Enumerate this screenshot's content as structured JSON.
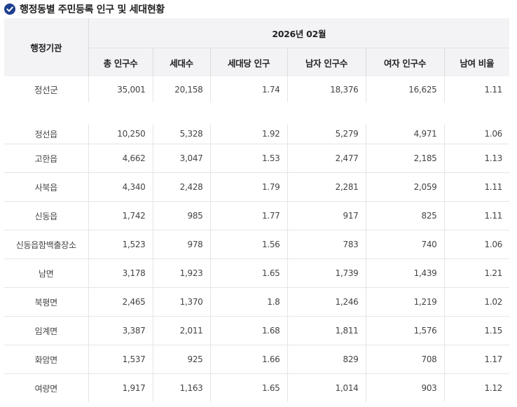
{
  "title": "행정동별 주민등록 인구 및 세대현황",
  "icon": "check-circle-icon",
  "accent_color": "#1d3f8f",
  "header": {
    "agency": "행정기관",
    "period": "2026년 02월",
    "columns": [
      "총 인구수",
      "세대수",
      "세대당 인구",
      "남자 인구수",
      "여자 인구수",
      "남여 비율"
    ]
  },
  "total": {
    "name": "정선군",
    "values": [
      "35,001",
      "20,158",
      "1.74",
      "18,376",
      "16,625",
      "1.11"
    ]
  },
  "rows": [
    {
      "name": "정선읍",
      "values": [
        "10,250",
        "5,328",
        "1.92",
        "5,279",
        "4,971",
        "1.06"
      ]
    },
    {
      "name": "고한읍",
      "values": [
        "4,662",
        "3,047",
        "1.53",
        "2,477",
        "2,185",
        "1.13"
      ]
    },
    {
      "name": "사북읍",
      "values": [
        "4,340",
        "2,428",
        "1.79",
        "2,281",
        "2,059",
        "1.11"
      ]
    },
    {
      "name": "신동읍",
      "values": [
        "1,742",
        "985",
        "1.77",
        "917",
        "825",
        "1.11"
      ]
    },
    {
      "name": "신동읍함백출장소",
      "values": [
        "1,523",
        "978",
        "1.56",
        "783",
        "740",
        "1.06"
      ]
    },
    {
      "name": "남면",
      "values": [
        "3,178",
        "1,923",
        "1.65",
        "1,739",
        "1,439",
        "1.21"
      ]
    },
    {
      "name": "북평면",
      "values": [
        "2,465",
        "1,370",
        "1.8",
        "1,246",
        "1,219",
        "1.02"
      ]
    },
    {
      "name": "임계면",
      "values": [
        "3,387",
        "2,011",
        "1.68",
        "1,811",
        "1,576",
        "1.15"
      ]
    },
    {
      "name": "화암면",
      "values": [
        "1,537",
        "925",
        "1.66",
        "829",
        "708",
        "1.17"
      ]
    },
    {
      "name": "여량면",
      "values": [
        "1,917",
        "1,163",
        "1.65",
        "1,014",
        "903",
        "1.12"
      ]
    }
  ]
}
